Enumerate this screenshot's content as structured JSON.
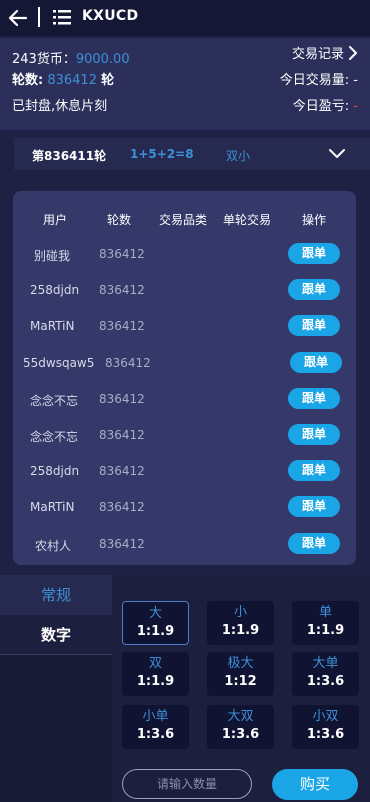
{
  "header": {
    "title": "KXUCD"
  },
  "account": {
    "currency_label": "243货币：",
    "currency_value": "9000.00",
    "round_label": "轮数:",
    "round_value": "836412",
    "round_suffix": "轮",
    "status": "已封盘,休息片刻",
    "trade_record_label": "交易记录",
    "today_volume_label": "今日交易量:",
    "today_volume_value": "-",
    "today_profit_label": "今日盈亏:",
    "today_profit_value": "-"
  },
  "last_round": {
    "label": "第836411轮",
    "formula": "1+5+2=8",
    "result": "双小"
  },
  "table": {
    "headers": [
      "用户",
      "轮数",
      "交易品类",
      "单轮交易",
      "操作"
    ],
    "follow_label": "跟单",
    "rows": [
      {
        "user": "别碰我",
        "round": "836412"
      },
      {
        "user": "258djdn",
        "round": "836412"
      },
      {
        "user": "MaRTiN",
        "round": "836412"
      },
      {
        "user": "55dwsqaw5",
        "round": "836412"
      },
      {
        "user": "念念不忘",
        "round": "836412"
      },
      {
        "user": "念念不忘",
        "round": "836412"
      },
      {
        "user": "258djdn",
        "round": "836412"
      },
      {
        "user": "MaRTiN",
        "round": "836412"
      },
      {
        "user": "农村人",
        "round": "836412"
      }
    ]
  },
  "tabs": {
    "normal": "常规",
    "digit": "数字",
    "active": "normal"
  },
  "bets": [
    {
      "name": "大",
      "odds": "1:1.9",
      "selected": true
    },
    {
      "name": "小",
      "odds": "1:1.9"
    },
    {
      "name": "单",
      "odds": "1:1.9"
    },
    {
      "name": "双",
      "odds": "1:1.9"
    },
    {
      "name": "极大",
      "odds": "1:12"
    },
    {
      "name": "大单",
      "odds": "1:3.6"
    },
    {
      "name": "小单",
      "odds": "1:3.6"
    },
    {
      "name": "大双",
      "odds": "1:3.6"
    },
    {
      "name": "小双",
      "odds": "1:3.6"
    }
  ],
  "purchase": {
    "placeholder": "请输入数量",
    "buy_label": "购买"
  },
  "colors": {
    "accent": "#1aa6e6",
    "link_blue": "#3e8fd8",
    "bg": "#1e2144"
  }
}
